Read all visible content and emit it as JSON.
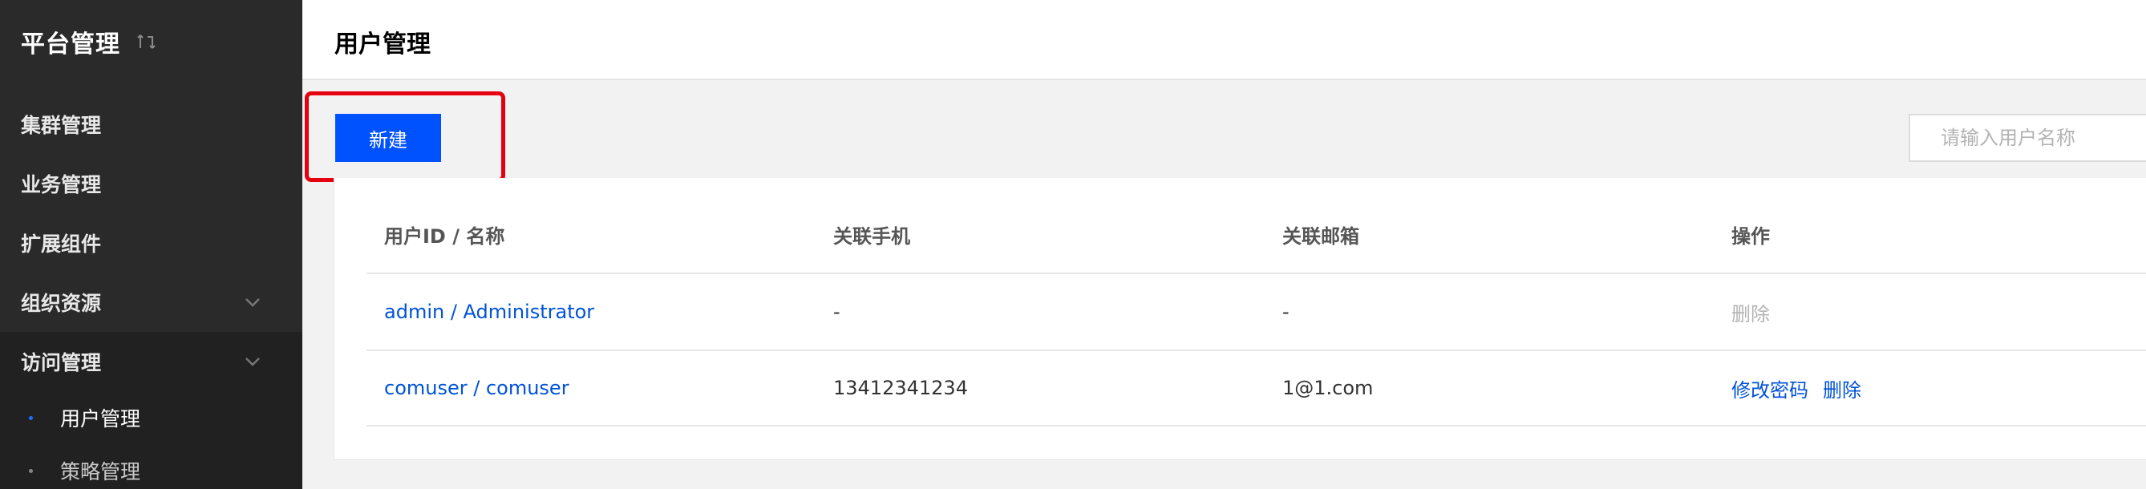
{
  "sidebar": {
    "title": "平台管理",
    "items": [
      {
        "label": "集群管理"
      },
      {
        "label": "业务管理"
      },
      {
        "label": "扩展组件"
      },
      {
        "label": "组织资源"
      },
      {
        "label": "访问管理"
      }
    ],
    "sub_items": [
      {
        "label": "用户管理",
        "active": true
      },
      {
        "label": "策略管理",
        "active": false
      }
    ]
  },
  "header": {
    "title": "用户管理"
  },
  "toolbar": {
    "new_label": "新建",
    "search_placeholder": "请输入用户名称"
  },
  "table": {
    "columns": [
      "用户ID / 名称",
      "关联手机",
      "关联邮箱",
      "操作"
    ],
    "rows": [
      {
        "name": "admin / Administrator",
        "phone": "-",
        "email": "-",
        "actions": [
          "删除"
        ]
      },
      {
        "name": "comuser / comuser",
        "phone": "13412341234",
        "email": "1@1.com",
        "actions": [
          "修改密码",
          "删除"
        ]
      }
    ]
  },
  "colors": {
    "accent": "#0052ff",
    "highlight": "#e6000f",
    "sidebar_bg": "#2a2a2a"
  },
  "icons": [
    "switch-icon",
    "chevron-down-icon"
  ]
}
